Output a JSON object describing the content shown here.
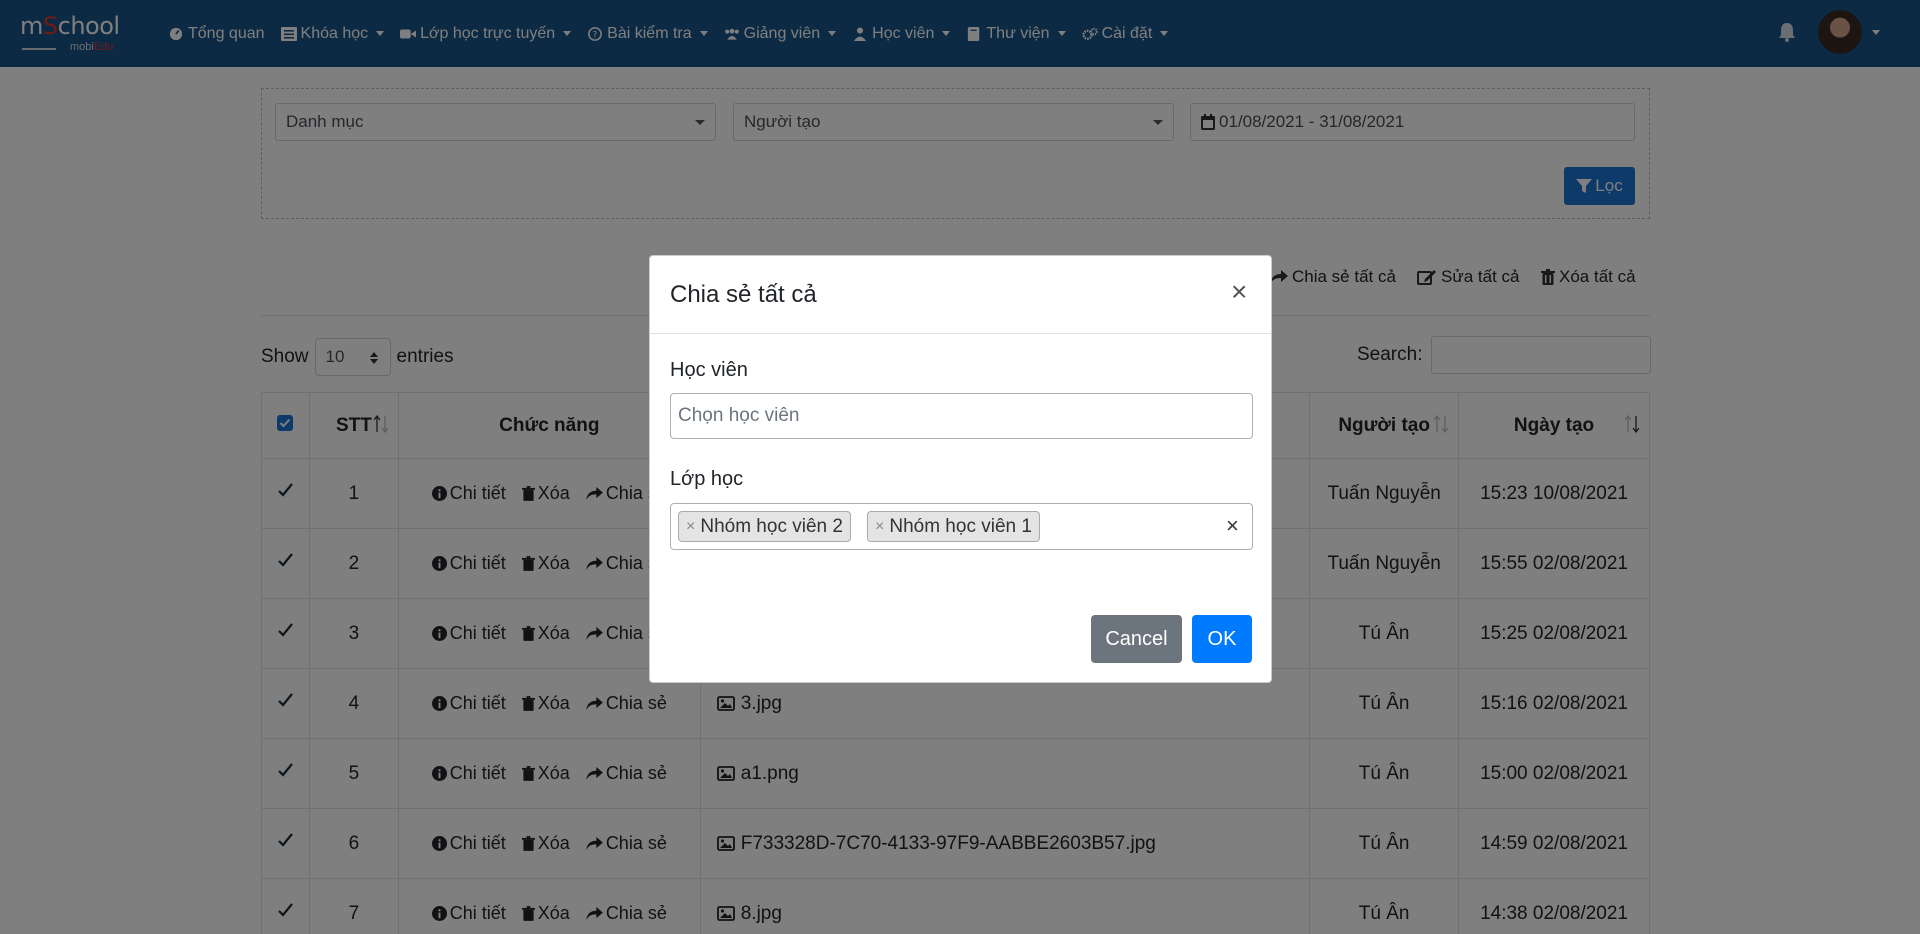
{
  "brand": {
    "logo_main_prefix": "m",
    "logo_main_s": "S",
    "logo_main_suffix": "chool",
    "logo_sub_prefix": "mobi",
    "logo_sub_suffix": "Edu"
  },
  "nav": [
    {
      "label": "Tổng quan",
      "icon": "dashboard-icon",
      "dropdown": false
    },
    {
      "label": "Khóa học",
      "icon": "list-icon",
      "dropdown": true
    },
    {
      "label": "Lớp học trực tuyến",
      "icon": "video-icon",
      "dropdown": true
    },
    {
      "label": "Bài kiểm tra",
      "icon": "question-icon",
      "dropdown": true
    },
    {
      "label": "Giảng viên",
      "icon": "users-icon",
      "dropdown": true
    },
    {
      "label": "Học viên",
      "icon": "user-icon",
      "dropdown": true
    },
    {
      "label": "Thư viện",
      "icon": "book-icon",
      "dropdown": true
    },
    {
      "label": "Cài đặt",
      "icon": "cogs-icon",
      "dropdown": true
    }
  ],
  "filter": {
    "category_placeholder": "Danh mục",
    "creator_placeholder": "Người tạo",
    "date_range": "01/08/2021 - 31/08/2021",
    "filter_button": "Lọc"
  },
  "bulk": {
    "share_all": "Chia sẻ tất cả",
    "edit_all": "Sửa tất cả",
    "delete_all": "Xóa tất cả"
  },
  "table_controls": {
    "show": "Show",
    "entries": "entries",
    "page_length": "10",
    "search_label": "Search:"
  },
  "table": {
    "headers": {
      "stt": "STT",
      "actions": "Chức năng",
      "creator": "Người tạo",
      "created": "Ngày tạo"
    },
    "action_labels": {
      "detail": "Chi tiết",
      "delete": "Xóa",
      "share": "Chia sẻ"
    },
    "rows": [
      {
        "stt": "1",
        "file": "",
        "creator": "Tuấn Nguyễn",
        "created": "15:23 10/08/2021"
      },
      {
        "stt": "2",
        "file": "",
        "creator": "Tuấn Nguyễn",
        "created": "15:55 02/08/2021"
      },
      {
        "stt": "3",
        "file": "",
        "creator": "Tú Ân",
        "created": "15:25 02/08/2021"
      },
      {
        "stt": "4",
        "file": "3.jpg",
        "creator": "Tú Ân",
        "created": "15:16 02/08/2021"
      },
      {
        "stt": "5",
        "file": "a1.png",
        "creator": "Tú Ân",
        "created": "15:00 02/08/2021"
      },
      {
        "stt": "6",
        "file": "F733328D-7C70-4133-97F9-AABBE2603B57.jpg",
        "creator": "Tú Ân",
        "created": "14:59 02/08/2021"
      },
      {
        "stt": "7",
        "file": "8.jpg",
        "creator": "Tú Ân",
        "created": "14:38 02/08/2021"
      }
    ]
  },
  "modal": {
    "title": "Chia sẻ tất cả",
    "student_label": "Học viên",
    "student_placeholder": "Chọn học viên",
    "class_label": "Lớp học",
    "selected_classes": [
      "Nhóm học viên 2",
      "Nhóm học viên 1"
    ],
    "tag_remove": "×",
    "clear": "×",
    "close": "×",
    "cancel": "Cancel",
    "ok": "OK"
  },
  "colors": {
    "navbar": "#1b5589",
    "primary": "#007bff",
    "filter_button": "#1b74d1",
    "secondary": "#6c757d",
    "logo_accent": "#e2342f"
  }
}
